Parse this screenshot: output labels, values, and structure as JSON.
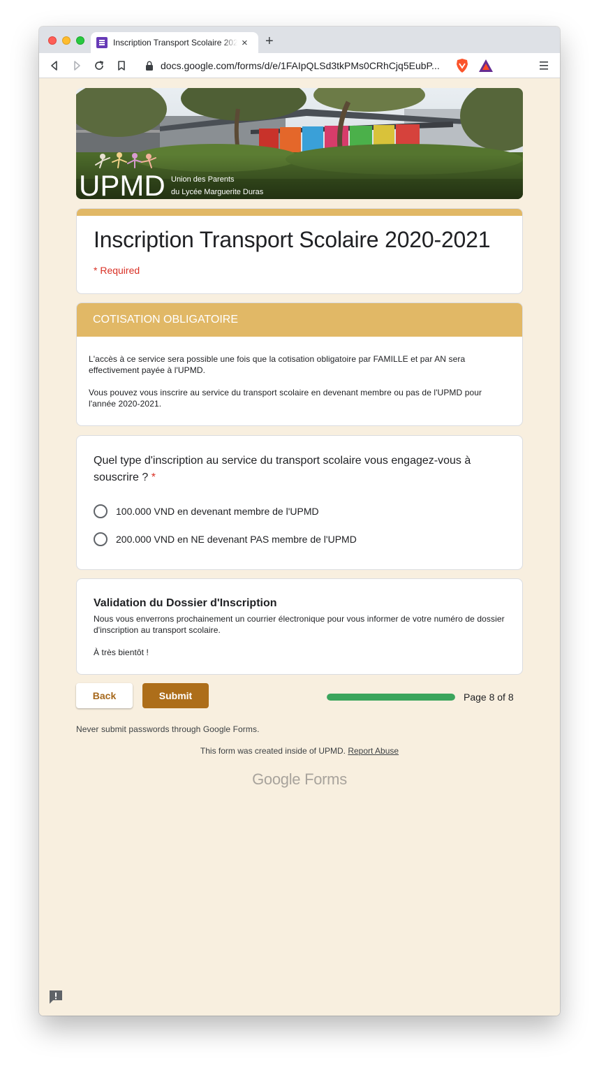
{
  "browser": {
    "tab_title": "Inscription Transport Scolaire 2020-2021",
    "tab_close": "×",
    "new_tab": "+",
    "url": "docs.google.com/forms/d/e/1FAIpQLSd3tkPMs0CRhCjq5EubP..."
  },
  "banner": {
    "logo_text": "UPMD",
    "line1": "Union des Parents",
    "line2": "du Lycée Marguerite Duras"
  },
  "form": {
    "title": "Inscription Transport Scolaire 2020-2021",
    "required_note": "* Required"
  },
  "section": {
    "header": "COTISATION OBLIGATOIRE",
    "paragraph1": "L'accès à ce service sera possible une fois que la cotisation obligatoire par FAMILLE et par AN sera effectivement payée à l'UPMD.",
    "paragraph2": "Vous pouvez vous inscrire au service du transport scolaire en devenant membre ou pas de l'UPMD pour l'année 2020-2021."
  },
  "question": {
    "text": "Quel type d'inscription au service du transport scolaire vous engagez-vous à souscrire ?",
    "required_mark": "*",
    "options": [
      "100.000 VND en devenant membre de l'UPMD",
      "200.000 VND en NE devenant PAS membre de l'UPMD"
    ]
  },
  "validation": {
    "title": "Validation du Dossier d'Inscription",
    "paragraph1": "Nous vous enverrons prochainement un courrier électronique pour vous informer de votre numéro de dossier d'inscription au transport scolaire.",
    "paragraph2": "À très bientôt !"
  },
  "navigation": {
    "back_label": "Back",
    "submit_label": "Submit",
    "progress_fraction": 1.0,
    "page_indicator": "Page 8 of 8"
  },
  "footer": {
    "warning": "Never submit passwords through Google Forms.",
    "created_by": "This form was created inside of UPMD.",
    "report_link": "Report Abuse",
    "logo_google": "Google",
    "logo_forms": "Forms"
  },
  "colors": {
    "accent": "#e1b866",
    "submit": "#ad6e1a",
    "background": "#f8efdf",
    "progress": "#3ba55c",
    "required": "#d93025"
  }
}
